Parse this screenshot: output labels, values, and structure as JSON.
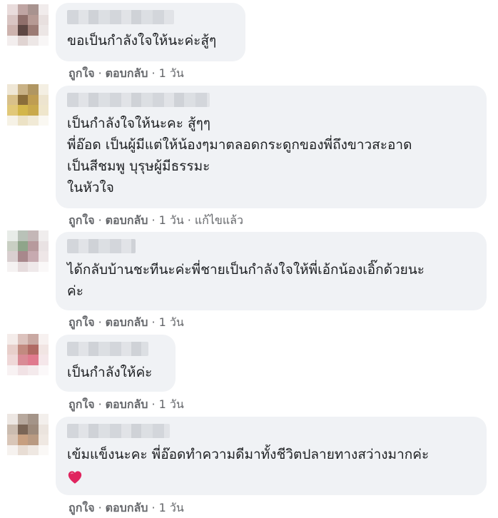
{
  "comments": [
    {
      "text": "ขอเป็นกำลังใจให้นะค่ะสู้ๆ",
      "like": "ถูกใจ",
      "reply": "ตอบกลับ",
      "time": "1 วัน",
      "edited": ""
    },
    {
      "text": "เป็นกำลังใจให้นะคะ สู้ๆๆ\nพี่อ๊อด เป็นผู้มีแต่ให้น้องๆมาตลอดกระดูกของพี่ถึงขาวสะอาด\nเป็นสีชมพู บุรุษผู้มีธรรมะ\nในหัวใจ",
      "like": "ถูกใจ",
      "reply": "ตอบกลับ",
      "time": "1 วัน",
      "edited": "แก้ไขแล้ว"
    },
    {
      "text": "ได้กลับบ้านชะทีนะค่ะพี่ชายเป็นกำลังใจให้พี่เอ้กน้องเอิ๊กด้วยนะ\nค่ะ",
      "like": "ถูกใจ",
      "reply": "ตอบกลับ",
      "time": "1 วัน",
      "edited": ""
    },
    {
      "text": "เป็นกำลังให้ค่ะ",
      "like": "ถูกใจ",
      "reply": "ตอบกลับ",
      "time": "1 วัน",
      "edited": ""
    },
    {
      "text": "เข้มแข็งนะคะ พี่อ๊อดทำความดีมาทั้งชีวิตปลายทางสว่างมากค่ะ",
      "emoji": "red-heart",
      "like": "ถูกใจ",
      "reply": "ตอบกลับ",
      "time": "1 วัน",
      "edited": ""
    }
  ],
  "separator": "·",
  "colors": {
    "bubble": "#f0f2f5",
    "meta": "#65676b",
    "heart": "#e0245e"
  }
}
